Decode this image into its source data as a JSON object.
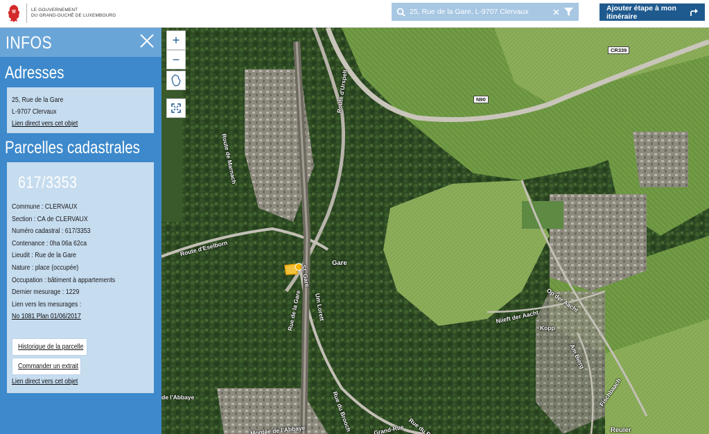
{
  "header": {
    "logo_line1": "LE GOUVERNEMENT",
    "logo_line2": "DU GRAND-DUCHÉ DE LUXEMBOURG",
    "search_value": "25, Rue de la Gare, L-9707 Clervaux",
    "add_stage_label": "Ajouter étape à mon itinéraire"
  },
  "panel": {
    "title": "INFOS",
    "addresses_title": "Adresses",
    "address_line1": "25, Rue de la Gare",
    "address_line2": "L-9707 Clervaux",
    "address_link": "Lien direct vers cet objet",
    "parcels_title": "Parcelles cadastrales",
    "parcel_number": "617/3353",
    "fields": [
      "Commune : CLERVAUX",
      "Section : CA de CLERVAUX",
      "Numéro cadastral : 617/3353",
      "Contenance : 0ha 06a 62ca",
      "Lieudit : Rue de la Gare",
      "Nature : place (occupée)",
      "Occupation : bâtiment à appartements",
      "Dernier mesurage : 1229",
      "Lien vers les mesurages :"
    ],
    "measurement_link": "No 1081 Plan 01/06/2017",
    "history_button": "Historique de la parcelle",
    "extract_button": "Commander un extrait",
    "parcel_link": "Lien direct vers cet objet"
  },
  "map": {
    "zoom_in": "+",
    "zoom_out": "−",
    "labels": {
      "cr339": "CR339",
      "n90": "N90",
      "gare": "Gare",
      "route_eselborn": "Route d'Eselborn",
      "route_marnach": "Route de Marnach",
      "route_urspelt": "Route d'Urspelt",
      "rue_gare": "Rue de la Gare",
      "gare_side": "St. Gare",
      "um_lorett": "Um Lorett",
      "nieft": "Niieft der Aacht",
      "kopp": "Kopp",
      "op_der_aacht": "Op der Aacht",
      "am_bierg": "Am Bierg",
      "fischbaach": "Fischbaach",
      "reuler": "Reuler",
      "abbaye": "de l'Abbaye",
      "montee_abbaye": "Montée de l'Abbaye",
      "rue_brooch": "Rue du Brooch",
      "grand_rue": "Grand-Rue",
      "rue_du_parc": "Rue du Parc"
    }
  },
  "colors": {
    "panel_bg": "#3d89cb",
    "panel_head": "#6aa5d8",
    "box_bg": "#c6dcef",
    "accent": "#1f5a8f",
    "search_bg": "#a7c7e3"
  }
}
